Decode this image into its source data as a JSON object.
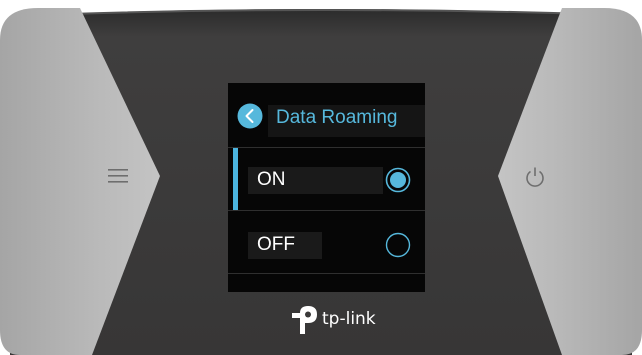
{
  "device": {
    "brand": "tp-link",
    "colors": {
      "body_dark": "#3a3939",
      "body_grey": "#b3b3b3",
      "accent": "#56b8dc",
      "screen_bg": "#060606"
    }
  },
  "side_buttons": {
    "left_icon": "menu-icon",
    "right_icon": "power-icon"
  },
  "screen": {
    "header": {
      "back_icon": "chevron-left-icon",
      "title": "Data Roaming"
    },
    "options": [
      {
        "label": "ON",
        "selected": true
      },
      {
        "label": "OFF",
        "selected": false
      }
    ]
  }
}
